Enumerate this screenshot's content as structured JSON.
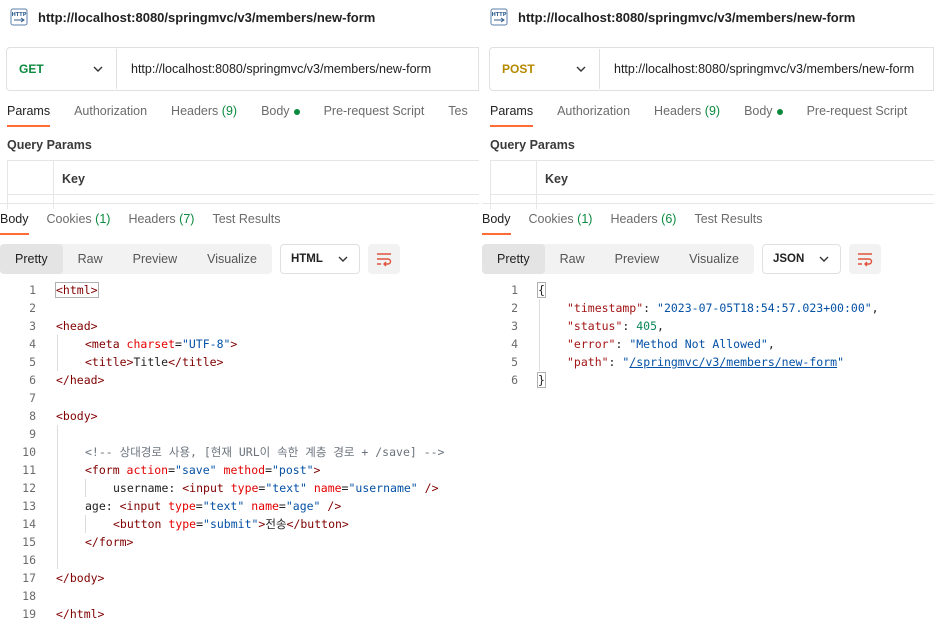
{
  "left": {
    "title": "http://localhost:8080/springmvc/v3/members/new-form",
    "method": "GET",
    "url": "http://localhost:8080/springmvc/v3/members/new-form",
    "request_tabs": [
      "Params",
      "Authorization",
      "Headers",
      "(9)",
      "Body",
      "Pre-request Script",
      "Tes"
    ],
    "query_params_title": "Query Params",
    "key_header": "Key",
    "response_tabs": [
      "Body",
      "Cookies",
      "(1)",
      "Headers",
      "(7)",
      "Test Results"
    ],
    "view_options": [
      "Pretty",
      "Raw",
      "Preview",
      "Visualize"
    ],
    "format": "HTML",
    "line_numbers": [
      "1",
      "2",
      "3",
      "4",
      "5",
      "6",
      "7",
      "8",
      "9",
      "10",
      "11",
      "12",
      "13",
      "14",
      "15",
      "16",
      "17",
      "18",
      "19"
    ],
    "code": {
      "l1": "<html>",
      "l3": "<head>",
      "l4_open": "<meta ",
      "l4_attr": "charset",
      "l4_eq": "=",
      "l4_val": "\"UTF-8\"",
      "l4_close": ">",
      "l5_open": "<title>",
      "l5_text": "Title",
      "l5_close": "</title>",
      "l6": "</head>",
      "l8": "<body>",
      "l10": "<!-- 상대경로 사용, [현재 URL이 속한 계층 경로 + /save] -->",
      "l11_open": "<form ",
      "l11_a1": "action",
      "l11_v1": "\"save\"",
      "l11_a2": "method",
      "l11_v2": "\"post\"",
      "l11_close": ">",
      "l12_text": "username: ",
      "l12_open": "<input ",
      "l12_a1": "type",
      "l12_v1": "\"text\"",
      "l12_a2": "name",
      "l12_v2": "\"username\"",
      "l12_close": " />",
      "l13_text": "age: ",
      "l13_open": "<input ",
      "l13_a1": "type",
      "l13_v1": "\"text\"",
      "l13_a2": "name",
      "l13_v2": "\"age\"",
      "l13_close": " />",
      "l14_open": "<button ",
      "l14_a1": "type",
      "l14_v1": "\"submit\"",
      "l14_gt": ">",
      "l14_text": "전송",
      "l14_close": "</button>",
      "l15": "</form>",
      "l17": "</body>",
      "l19": "</html>"
    }
  },
  "right": {
    "title": "http://localhost:8080/springmvc/v3/members/new-form",
    "method": "POST",
    "url": "http://localhost:8080/springmvc/v3/members/new-form",
    "request_tabs": [
      "Params",
      "Authorization",
      "Headers",
      "(9)",
      "Body",
      "Pre-request Script"
    ],
    "query_params_title": "Query Params",
    "key_header": "Key",
    "response_tabs": [
      "Body",
      "Cookies",
      "(1)",
      "Headers",
      "(6)",
      "Test Results"
    ],
    "view_options": [
      "Pretty",
      "Raw",
      "Preview",
      "Visualize"
    ],
    "format": "JSON",
    "line_numbers": [
      "1",
      "2",
      "3",
      "4",
      "5",
      "6"
    ],
    "json": {
      "open": "{",
      "k1": "\"timestamp\"",
      "v1": "\"2023-07-05T18:54:57.023+00:00\"",
      "k2": "\"status\"",
      "v2": "405",
      "k3": "\"error\"",
      "v3": "\"Method Not Allowed\"",
      "k4": "\"path\"",
      "v4_q1": "\"",
      "v4": "/springmvc/v3/members/new-form",
      "v4_q2": "\"",
      "close": "}"
    }
  },
  "colors": {
    "accent": "#ff6c37",
    "get": "#0b8a3e",
    "post": "#b58a00"
  },
  "icons": [
    "http-icon",
    "chevron-down-icon",
    "wrap-lines-icon",
    "status-dot-icon"
  ]
}
